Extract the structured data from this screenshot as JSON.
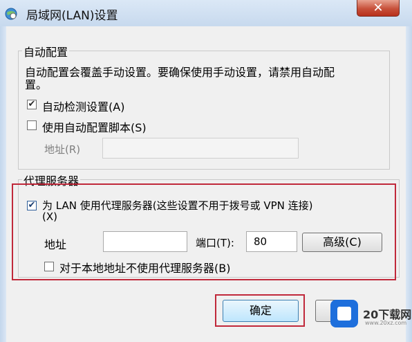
{
  "window": {
    "title": "局域网(LAN)设置",
    "close_symbol": "✕"
  },
  "auto_config": {
    "legend": "自动配置",
    "description_line1": "自动配置会覆盖手动设置。要确保使用手动设置，请禁用自动配",
    "description_line2": "置。",
    "auto_detect_label": "自动检测设置(A)",
    "auto_detect_checked": true,
    "use_script_label": "使用自动配置脚本(S)",
    "use_script_checked": false,
    "address_label": "地址(R)",
    "address_value": ""
  },
  "proxy": {
    "legend": "代理服务器",
    "use_proxy_label_line1": "为 LAN 使用代理服务器(这些设置不用于拨号或 VPN 连接)",
    "use_proxy_label_line2": "(X)",
    "use_proxy_checked": true,
    "address_label": "地址",
    "address_value": "",
    "port_label": "端口(T):",
    "port_value": "80",
    "advanced_label": "高级(C)",
    "bypass_local_label": "对于本地地址不使用代理服务器(B)",
    "bypass_local_checked": false
  },
  "footer": {
    "ok_label": "确定"
  },
  "watermark": {
    "text": "20下载网",
    "small": "www.20xz.com"
  },
  "colors": {
    "highlight": "#c0283a",
    "title_bar": "#c7d9ee",
    "close_button": "#c7503a"
  }
}
